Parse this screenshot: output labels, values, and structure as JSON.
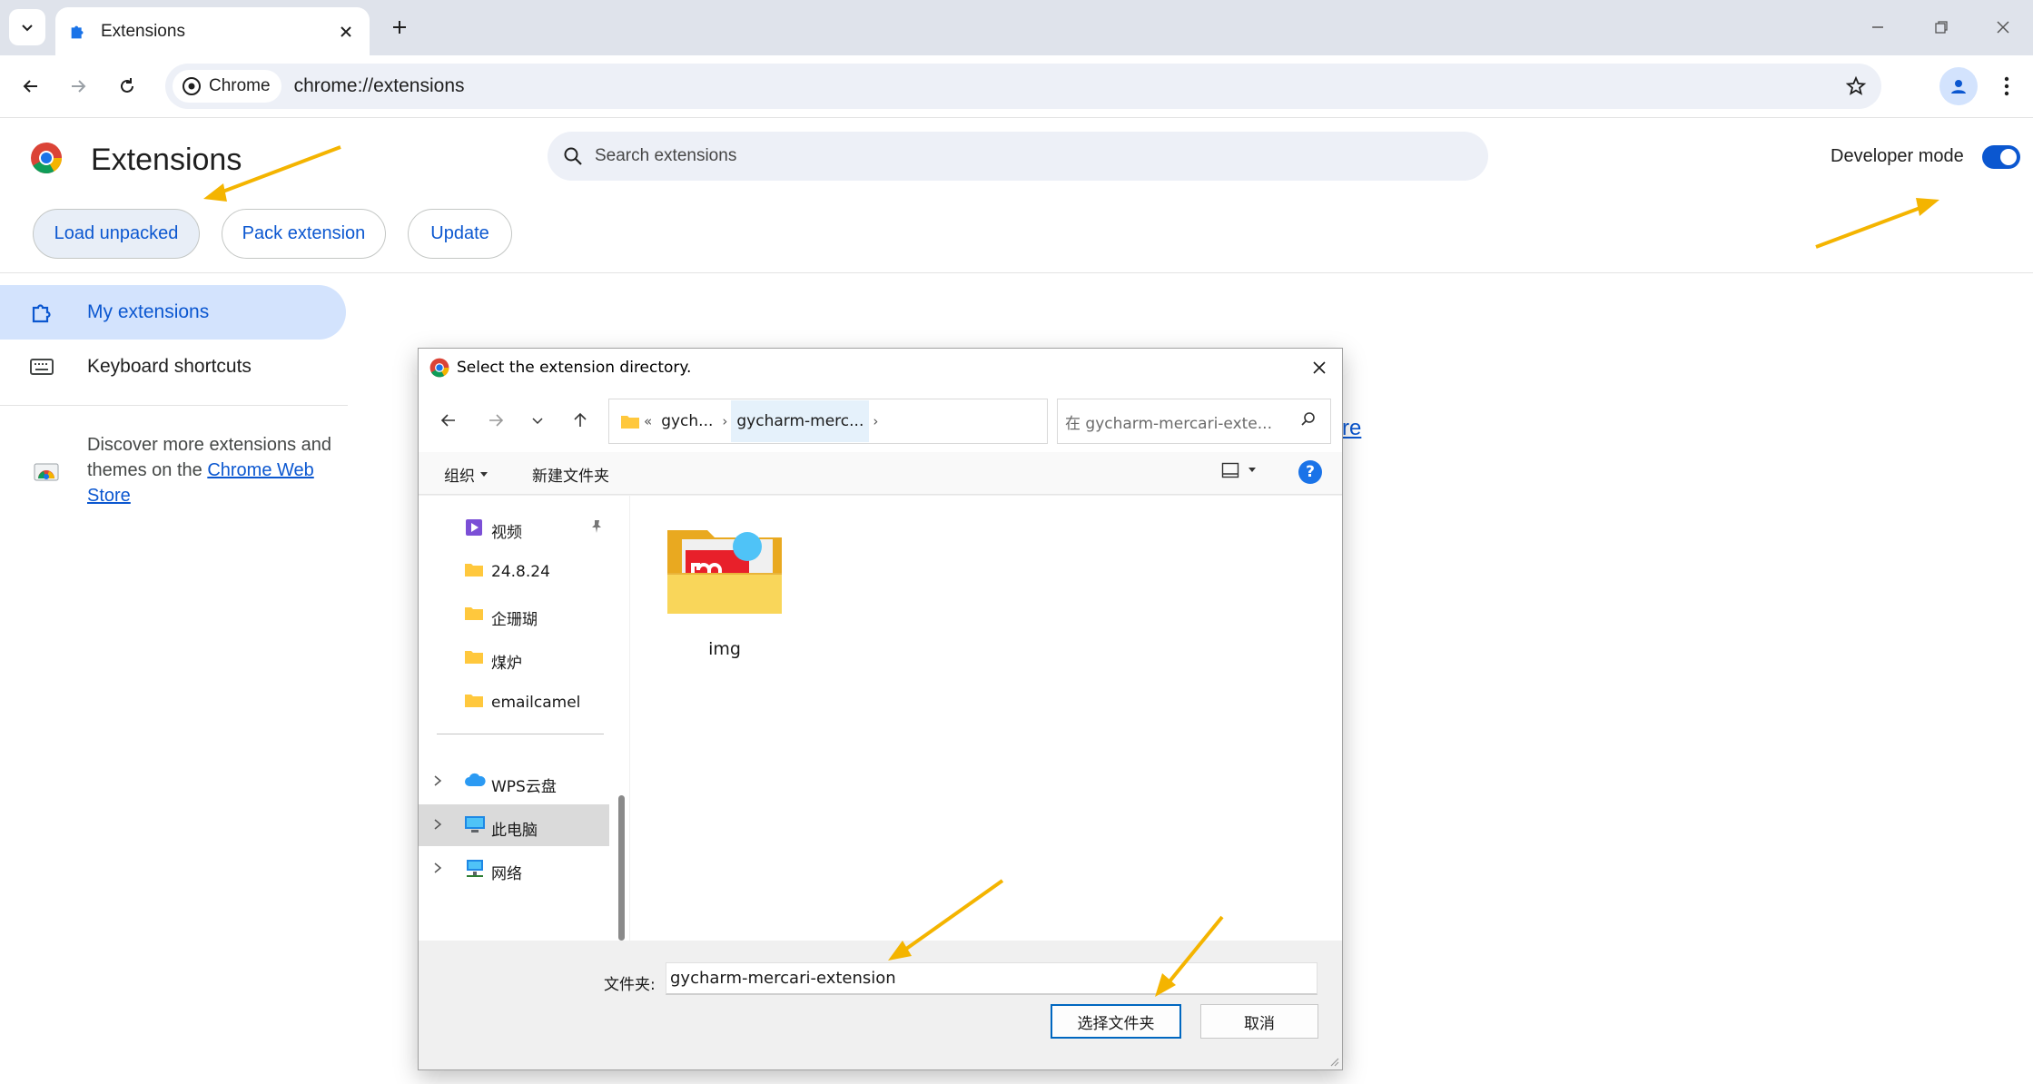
{
  "browser": {
    "tab_title": "Extensions",
    "chip_label": "Chrome",
    "url": "chrome://extensions"
  },
  "extensions_page": {
    "title": "Extensions",
    "search_placeholder": "Search extensions",
    "developer_mode_label": "Developer mode",
    "developer_mode_on": true,
    "buttons": {
      "load_unpacked": "Load unpacked",
      "pack_extension": "Pack extension",
      "update": "Update"
    },
    "sidebar": {
      "items": [
        {
          "label": "My extensions",
          "active": true,
          "icon": "puzzle-icon"
        },
        {
          "label": "Keyboard shortcuts",
          "active": false,
          "icon": "keyboard-icon"
        }
      ],
      "discover_text": "Discover more extensions and themes on the ",
      "store_link": "Chrome Web Store"
    },
    "peek_link_text": "re"
  },
  "dialog": {
    "title": "Select the extension directory.",
    "breadcrumbs": [
      "gych...",
      "gycharm-merc..."
    ],
    "breadcrumb_overflow": "«",
    "search_placeholder": "在 gycharm-mercari-exte...",
    "commands": {
      "organize": "组织",
      "new_folder": "新建文件夹"
    },
    "help": "?",
    "tree": {
      "quick": [
        {
          "label": "视频",
          "icon": "video-folder-icon",
          "pinned": true
        },
        {
          "label": "24.8.24",
          "icon": "folder-icon",
          "pinned": false
        },
        {
          "label": "企珊瑚",
          "icon": "folder-icon",
          "pinned": false
        },
        {
          "label": "煤炉",
          "icon": "folder-icon",
          "pinned": false
        },
        {
          "label": "emailcamel",
          "icon": "folder-icon",
          "pinned": false
        }
      ],
      "locations": [
        {
          "label": "WPS云盘",
          "icon": "cloud-icon",
          "selected": false
        },
        {
          "label": "此电脑",
          "icon": "computer-icon",
          "selected": true
        },
        {
          "label": "网络",
          "icon": "network-icon",
          "selected": false
        }
      ]
    },
    "files": [
      {
        "name": "img",
        "icon": "image-folder-icon"
      }
    ],
    "folder_label": "文件夹:",
    "folder_value": "gycharm-mercari-extension",
    "select_button": "选择文件夹",
    "cancel_button": "取消"
  },
  "colors": {
    "accent": "#0b57d0",
    "arrow": "#f4b400",
    "tab_strip": "#dfe3eb",
    "active_nav": "#d3e3fd"
  }
}
